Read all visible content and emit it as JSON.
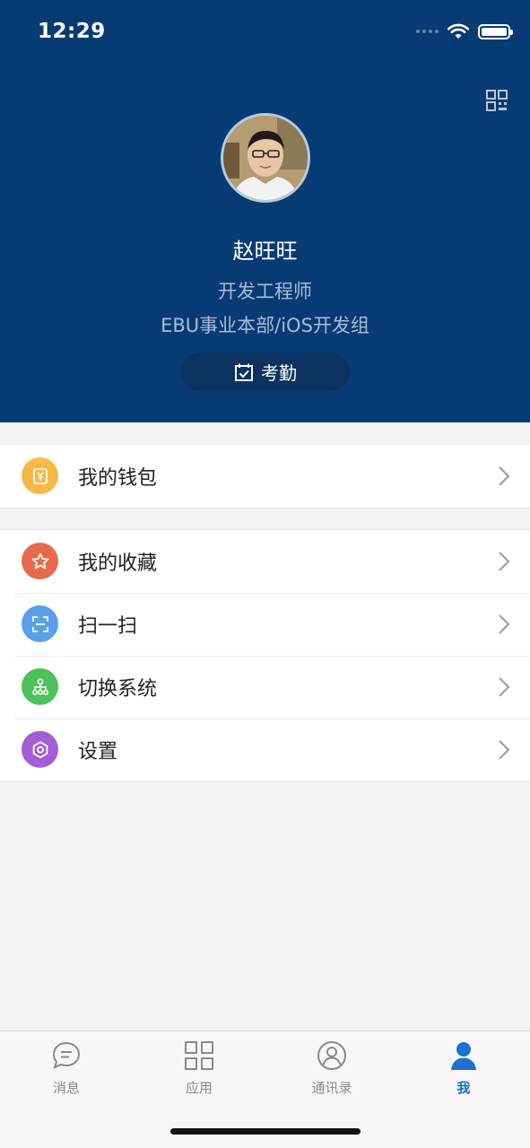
{
  "status_bar": {
    "time": "12:29"
  },
  "profile": {
    "name": "赵旺旺",
    "title": "开发工程师",
    "department": "EBU事业本部/iOS开发组",
    "attendance_label": "考勤"
  },
  "menu": {
    "group1": [
      {
        "label": "我的钱包",
        "icon": "wallet-icon",
        "color": "#f5b849"
      }
    ],
    "group2": [
      {
        "label": "我的收藏",
        "icon": "star-icon",
        "color": "#e9694c"
      },
      {
        "label": "扫一扫",
        "icon": "scan-icon",
        "color": "#5aa0ea"
      },
      {
        "label": "切换系统",
        "icon": "org-switch-icon",
        "color": "#4dc25c"
      },
      {
        "label": "设置",
        "icon": "settings-icon",
        "color": "#a35dd6"
      }
    ]
  },
  "tabbar": {
    "tabs": [
      {
        "label": "消息",
        "icon": "message-icon",
        "active": false
      },
      {
        "label": "应用",
        "icon": "apps-icon",
        "active": false
      },
      {
        "label": "通讯录",
        "icon": "contacts-icon",
        "active": false
      },
      {
        "label": "我",
        "icon": "me-icon",
        "active": true
      }
    ]
  },
  "colors": {
    "header_bg": "#063b73",
    "active_tab": "#1d6fd0"
  }
}
